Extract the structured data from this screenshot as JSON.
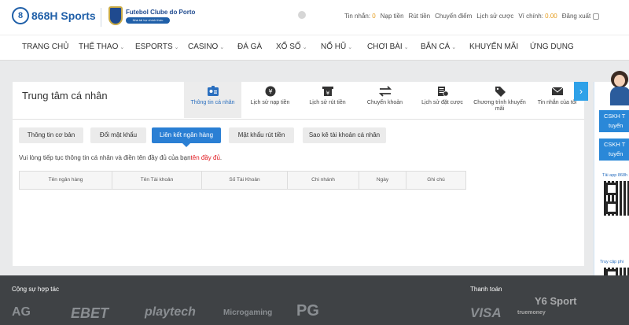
{
  "brand": {
    "logo_text": "868H Sports",
    "club_name": "Futebol Clube do Porto",
    "club_sub": "Nhà tài trợ chính thức"
  },
  "topbar": {
    "messages_label": "Tin nhắn:",
    "messages_count": "0",
    "deposit": "Nạp tiền",
    "withdraw": "Rút tiền",
    "transfer": "Chuyển điểm",
    "bet_history": "Lịch sử cược",
    "wallet_label": "Ví chính:",
    "wallet_value": "0.00",
    "logout": "Đăng xuất"
  },
  "nav": {
    "items": [
      {
        "label": "TRANG CHỦ"
      },
      {
        "label": "THỂ THAO"
      },
      {
        "label": "ESPORTS"
      },
      {
        "label": "CASINO"
      },
      {
        "label": "ĐÁ GÀ"
      },
      {
        "label": "XỔ SỐ"
      },
      {
        "label": "NỔ HŨ"
      },
      {
        "label": "CHƠI BÀI"
      },
      {
        "label": "BẮN CÁ"
      },
      {
        "label": "KHUYẾN MÃI"
      },
      {
        "label": "ỨNG DỤNG"
      }
    ]
  },
  "panel": {
    "title": "Trung tâm cá nhân",
    "tabs": [
      {
        "label": "Thông tin cá nhân",
        "icon": "id-card-icon"
      },
      {
        "label": "Lịch sử nạp tiền",
        "icon": "coin-icon"
      },
      {
        "label": "Lịch sử rút tiền",
        "icon": "yen-note-icon"
      },
      {
        "label": "Chuyển khoản",
        "icon": "transfer-arrows-icon"
      },
      {
        "label": "Lịch sử đặt cược",
        "icon": "coins-stack-icon"
      },
      {
        "label": "Chương trình khuyến mãi",
        "icon": "tag-icon"
      },
      {
        "label": "Tin nhắn của tôi",
        "icon": "envelope-icon"
      }
    ],
    "subtabs": [
      {
        "label": "Thông tin cơ bản"
      },
      {
        "label": "Đổi mật khẩu"
      },
      {
        "label": "Liên kết ngân hàng"
      },
      {
        "label": "Mật khẩu rút tiền"
      },
      {
        "label": "Sao kê tài khoản cá nhân"
      }
    ],
    "notice_text": "Vui lòng tiếp tục thông tin cá nhân và điền tên đầy đủ của bạn",
    "notice_red": "tên đầy đủ",
    "notice_end": ".",
    "table_headers": [
      "Tên ngân hàng",
      "Tên Tài khoản",
      "Số Tài Khoản",
      "Chi nhánh",
      "Ngày",
      "Ghi chú"
    ]
  },
  "support": {
    "cskh1_line1": "CSKH T",
    "cskh1_line2": "tuyến",
    "cskh2_line1": "CSKH T",
    "cskh2_line2": "tuyến",
    "tai_app": "Tải app 868h",
    "truy_cap": "Truy cập phi"
  },
  "footer": {
    "partners_title": "Cộng sự hợp tác",
    "payments_title": "Thanh toán",
    "partners": [
      "AG",
      "EBET",
      "playtech",
      "Microgaming",
      "PG"
    ],
    "payments": [
      "VISA",
      "truemoney"
    ],
    "watermark": "Y6 Sport"
  },
  "colors": {
    "accent": "#2a7fd4",
    "brand": "#1f5fa8",
    "highlight": "#e59a19",
    "alert": "#e0161d",
    "footer": "#3f4245"
  }
}
